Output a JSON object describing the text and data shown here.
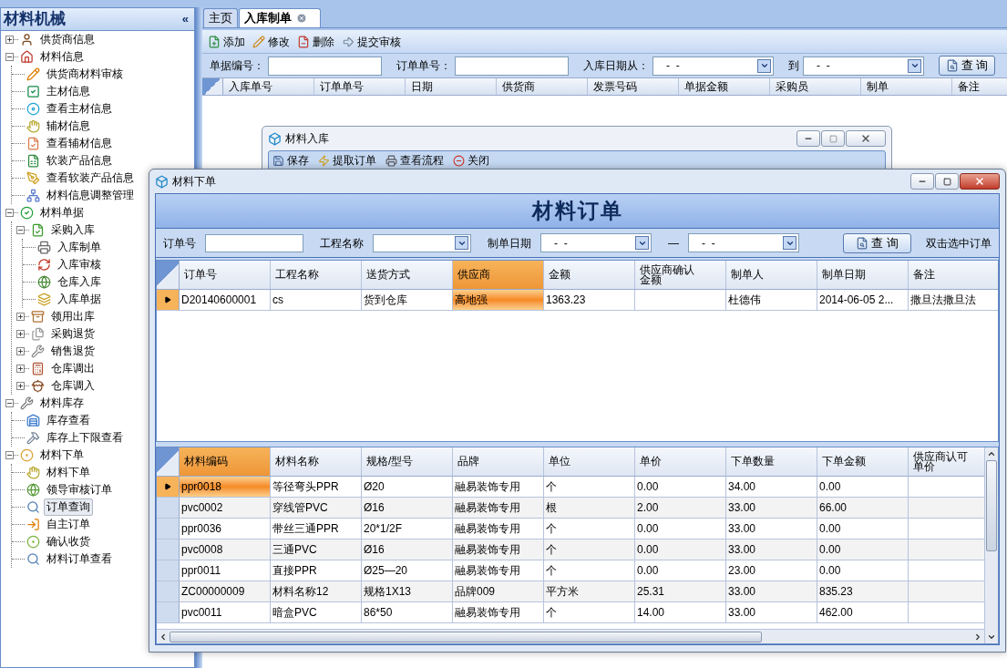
{
  "sidebar": {
    "title": "材料机械",
    "collapse": "«",
    "items": [
      {
        "label": "供货商信息",
        "selected": false,
        "expanded": false
      },
      {
        "label": "材料信息",
        "selected": false,
        "expanded": true,
        "children": [
          {
            "label": "供货商材料审核",
            "selected": false
          },
          {
            "label": "主材信息",
            "selected": false
          },
          {
            "label": "查看主材信息",
            "selected": false
          },
          {
            "label": "辅材信息",
            "selected": false
          },
          {
            "label": "查看辅材信息",
            "selected": false
          },
          {
            "label": "软装产品信息",
            "selected": false
          },
          {
            "label": "查看软装产品信息",
            "selected": false
          },
          {
            "label": "材料信息调整管理",
            "selected": false
          }
        ]
      },
      {
        "label": "材料单据",
        "selected": false,
        "expanded": true,
        "children": [
          {
            "label": "采购入库",
            "selected": false,
            "expanded": true,
            "children": [
              {
                "label": "入库制单",
                "selected": false
              },
              {
                "label": "入库审核",
                "selected": false
              },
              {
                "label": "仓库入库",
                "selected": false
              },
              {
                "label": "入库单据",
                "selected": false
              }
            ]
          },
          {
            "label": "领用出库",
            "selected": false,
            "expanded": false
          },
          {
            "label": "采购退货",
            "selected": false,
            "expanded": false
          },
          {
            "label": "销售退货",
            "selected": false,
            "expanded": false
          },
          {
            "label": "仓库调出",
            "selected": false,
            "expanded": false
          },
          {
            "label": "仓库调入",
            "selected": false,
            "expanded": false
          }
        ]
      },
      {
        "label": "材料库存",
        "selected": false,
        "expanded": true,
        "children": [
          {
            "label": "库存查看",
            "selected": false
          },
          {
            "label": "库存上下限查看",
            "selected": false
          }
        ]
      },
      {
        "label": "材料下单",
        "selected": false,
        "expanded": true,
        "children": [
          {
            "label": "材料下单",
            "selected": false
          },
          {
            "label": "领导审核订单",
            "selected": false
          },
          {
            "label": "订单查询",
            "selected": true
          },
          {
            "label": "自主订单",
            "selected": false
          },
          {
            "label": "确认收货",
            "selected": false
          },
          {
            "label": "材料订单查看",
            "selected": false
          }
        ]
      }
    ]
  },
  "tabs": [
    {
      "label": "主页",
      "selected": false
    },
    {
      "label": "入库制单",
      "selected": true
    }
  ],
  "toolbar": [
    {
      "label": "添加"
    },
    {
      "label": "修改"
    },
    {
      "label": "删除"
    },
    {
      "label": "提交审核"
    }
  ],
  "filters": [
    {
      "label": "单据编号：",
      "kind": "text"
    },
    {
      "label": "订单单号：",
      "kind": "text"
    },
    {
      "label": "入库日期从：",
      "kind": "date",
      "value": "-  -"
    },
    {
      "label": "到",
      "kind": "date",
      "value": "-  -"
    }
  ],
  "search_button": "查 询",
  "table": {
    "columns": [
      "入库单号",
      "订单单号",
      "日期",
      "供货商",
      "发票号码",
      "单据金额",
      "采购员",
      "制单",
      "备注"
    ]
  },
  "receipt_window": {
    "title": "材料入库",
    "toolbar": [
      "保存",
      "提取订单",
      "查看流程",
      "关闭"
    ]
  },
  "order_window": {
    "title": "材料下单",
    "heading": "材料订单",
    "filters": [
      {
        "label": "订单号",
        "kind": "text"
      },
      {
        "label": "工程名称",
        "kind": "combo"
      },
      {
        "label": "制单日期",
        "kind": "date",
        "value": "-  -"
      },
      {
        "label": "—",
        "kind": "date",
        "value": "-  -"
      }
    ],
    "search_button": "查 询",
    "hint": "双击选中订单",
    "orders": {
      "columns": [
        {
          "label": "订单号",
          "selected": false
        },
        {
          "label": "工程名称",
          "selected": false
        },
        {
          "label": "送货方式",
          "selected": false
        },
        {
          "label": "供应商",
          "selected": true
        },
        {
          "label": "金额",
          "selected": false
        },
        {
          "label": "供应商确认金额",
          "selected": false
        },
        {
          "label": "制单人",
          "selected": false
        },
        {
          "label": "制单日期",
          "selected": false
        },
        {
          "label": "备注",
          "selected": false
        }
      ],
      "rows": [
        {
          "selected": true,
          "cells": [
            "D20140600001",
            "cs",
            "货到仓库",
            "高地强",
            "1363.23",
            null,
            "杜德伟",
            "2014-06-05 2...",
            "撒旦法撒旦法"
          ]
        }
      ]
    },
    "items": {
      "columns": [
        {
          "label": "材料编码",
          "selected": true
        },
        {
          "label": "材料名称",
          "selected": false
        },
        {
          "label": "规格/型号",
          "selected": false
        },
        {
          "label": "品牌",
          "selected": false
        },
        {
          "label": "单位",
          "selected": false
        },
        {
          "label": "单价",
          "selected": false
        },
        {
          "label": "下单数量",
          "selected": false
        },
        {
          "label": "下单金额",
          "selected": false
        },
        {
          "label": "供应商认可单价",
          "selected": false
        }
      ],
      "rows": [
        {
          "selected": true,
          "cells": [
            "ppr0018",
            "等径弯头PPR",
            "Ø20",
            "融易装饰专用",
            "个",
            "0.00",
            "34.00",
            "0.00"
          ]
        },
        {
          "selected": false,
          "cells": [
            "pvc0002",
            "穿线管PVC",
            "Ø16",
            "融易装饰专用",
            "根",
            "2.00",
            "33.00",
            "66.00"
          ]
        },
        {
          "selected": false,
          "cells": [
            "ppr0036",
            "带丝三通PPR",
            "20*1/2F",
            "融易装饰专用",
            "个",
            "0.00",
            "33.00",
            "0.00"
          ]
        },
        {
          "selected": false,
          "cells": [
            "pvc0008",
            "三通PVC",
            "Ø16",
            "融易装饰专用",
            "个",
            "0.00",
            "33.00",
            "0.00"
          ]
        },
        {
          "selected": false,
          "cells": [
            "ppr0011",
            "直接PPR",
            "Ø25—20",
            "融易装饰专用",
            "个",
            "0.00",
            "23.00",
            "0.00"
          ]
        },
        {
          "selected": false,
          "cells": [
            "ZC00000009",
            "材料名称12",
            "规格1X13",
            "品牌009",
            "平方米",
            "25.31",
            "33.00",
            "835.23"
          ]
        },
        {
          "selected": false,
          "cells": [
            "pvc0011",
            "暗盒PVC",
            "86*50",
            "融易装饰专用",
            "个",
            "14.00",
            "33.00",
            "462.00"
          ]
        }
      ]
    }
  }
}
